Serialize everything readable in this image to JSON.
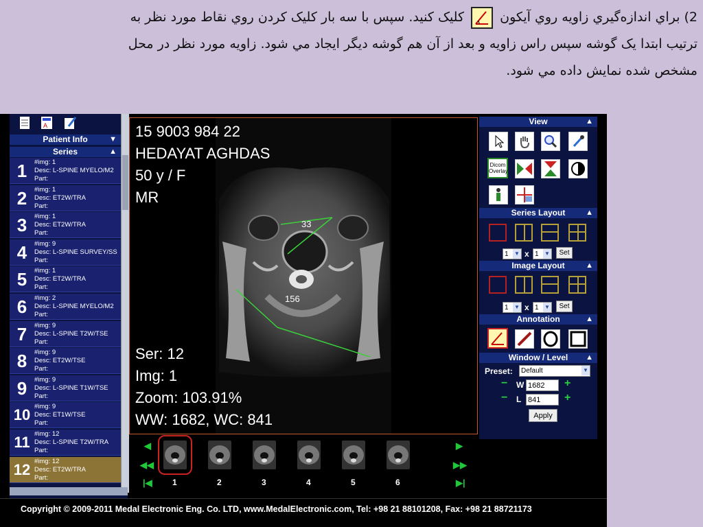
{
  "instruction": {
    "line1_part1": "2) براي اندازه‌گيري زاويه روي آيكون",
    "line1_part2": "كليک كنيد. سپس با سه بار كليک كردن روي نقاط مورد نظر به",
    "line2": "ترتيب ابتدا يک گوشه سپس راس زاويه و بعد از آن هم گوشه ديگر ايجاد مي شود. زاويه مورد نظر در محل",
    "line3": "مشخص شده نمايش داده مي شود."
  },
  "left_panel": {
    "patient_info_label": "Patient Info",
    "series_label": "Series",
    "series": [
      {
        "num": "1",
        "img": "#img: 1",
        "desc": "Desc: L-SPINE MYELO/M2",
        "part": "Part:"
      },
      {
        "num": "2",
        "img": "#img: 1",
        "desc": "Desc: ET2W/TRA",
        "part": "Part:"
      },
      {
        "num": "3",
        "img": "#img: 1",
        "desc": "Desc: ET2W/TRA",
        "part": "Part:"
      },
      {
        "num": "4",
        "img": "#img: 9",
        "desc": "Desc: L-SPINE SURVEY/SS",
        "part": "Part:"
      },
      {
        "num": "5",
        "img": "#img: 1",
        "desc": "Desc: ET2W/TRA",
        "part": "Part:"
      },
      {
        "num": "6",
        "img": "#img: 2",
        "desc": "Desc: L-SPINE MYELO/M2",
        "part": "Part:"
      },
      {
        "num": "7",
        "img": "#img: 9",
        "desc": "Desc: L-SPINE T2W/TSE",
        "part": "Part:"
      },
      {
        "num": "8",
        "img": "#img: 9",
        "desc": "Desc: ET2W/TSE",
        "part": "Part:"
      },
      {
        "num": "9",
        "img": "#img: 9",
        "desc": "Desc: L-SPINE T1W/TSE",
        "part": "Part:"
      },
      {
        "num": "10",
        "img": "#img: 9",
        "desc": "Desc: ET1W/TSE",
        "part": "Part:"
      },
      {
        "num": "11",
        "img": "#img: 12",
        "desc": "Desc: L-SPINE T2W/TRA",
        "part": "Part:"
      },
      {
        "num": "12",
        "img": "#img: 12",
        "desc": "Desc: ET2W/TRA",
        "part": "Part:"
      }
    ]
  },
  "viewer": {
    "patient_id": "15 9003 984 22",
    "patient_name": "HEDAYAT AGHDAS",
    "age_sex": "50 y / F",
    "modality": "MR",
    "ser": "Ser: 12",
    "img": "Img: 1",
    "zoom": "Zoom: 103.91%",
    "wwwc": "WW: 1682, WC: 841",
    "angle1": "33",
    "angle2": "156"
  },
  "thumbnails": {
    "labels": [
      "1",
      "2",
      "3",
      "4",
      "5",
      "6"
    ]
  },
  "right_panel": {
    "view_label": "View",
    "dicom_overlay_label": "Dicom Overlay",
    "series_layout_label": "Series Layout",
    "image_layout_label": "Image Layout",
    "annotation_label": "Annotation",
    "window_level_label": "Window / Level",
    "preset_label": "Preset:",
    "preset_value": "Default",
    "rows_value": "1",
    "cols_value": "1",
    "x_label": "x",
    "set_label": "Set",
    "w_label": "W",
    "l_label": "L",
    "w_value": "1682",
    "l_value": "841",
    "apply_label": "Apply",
    "minus": "−",
    "plus": "+"
  },
  "footer": {
    "copyright": "Copyright © 2009-2011 Medal Electronic Eng. Co. LTD, www.MedalElectronic.com, Tel: +98 21 88101208, Fax: +98 21 88721173"
  },
  "colors": {
    "panel_bg": "#0b1340",
    "header_bg": "#162a7a",
    "active_series": "#8c7436",
    "measure_line": "#3bd13b",
    "slide_bg": "#cbbfda"
  }
}
